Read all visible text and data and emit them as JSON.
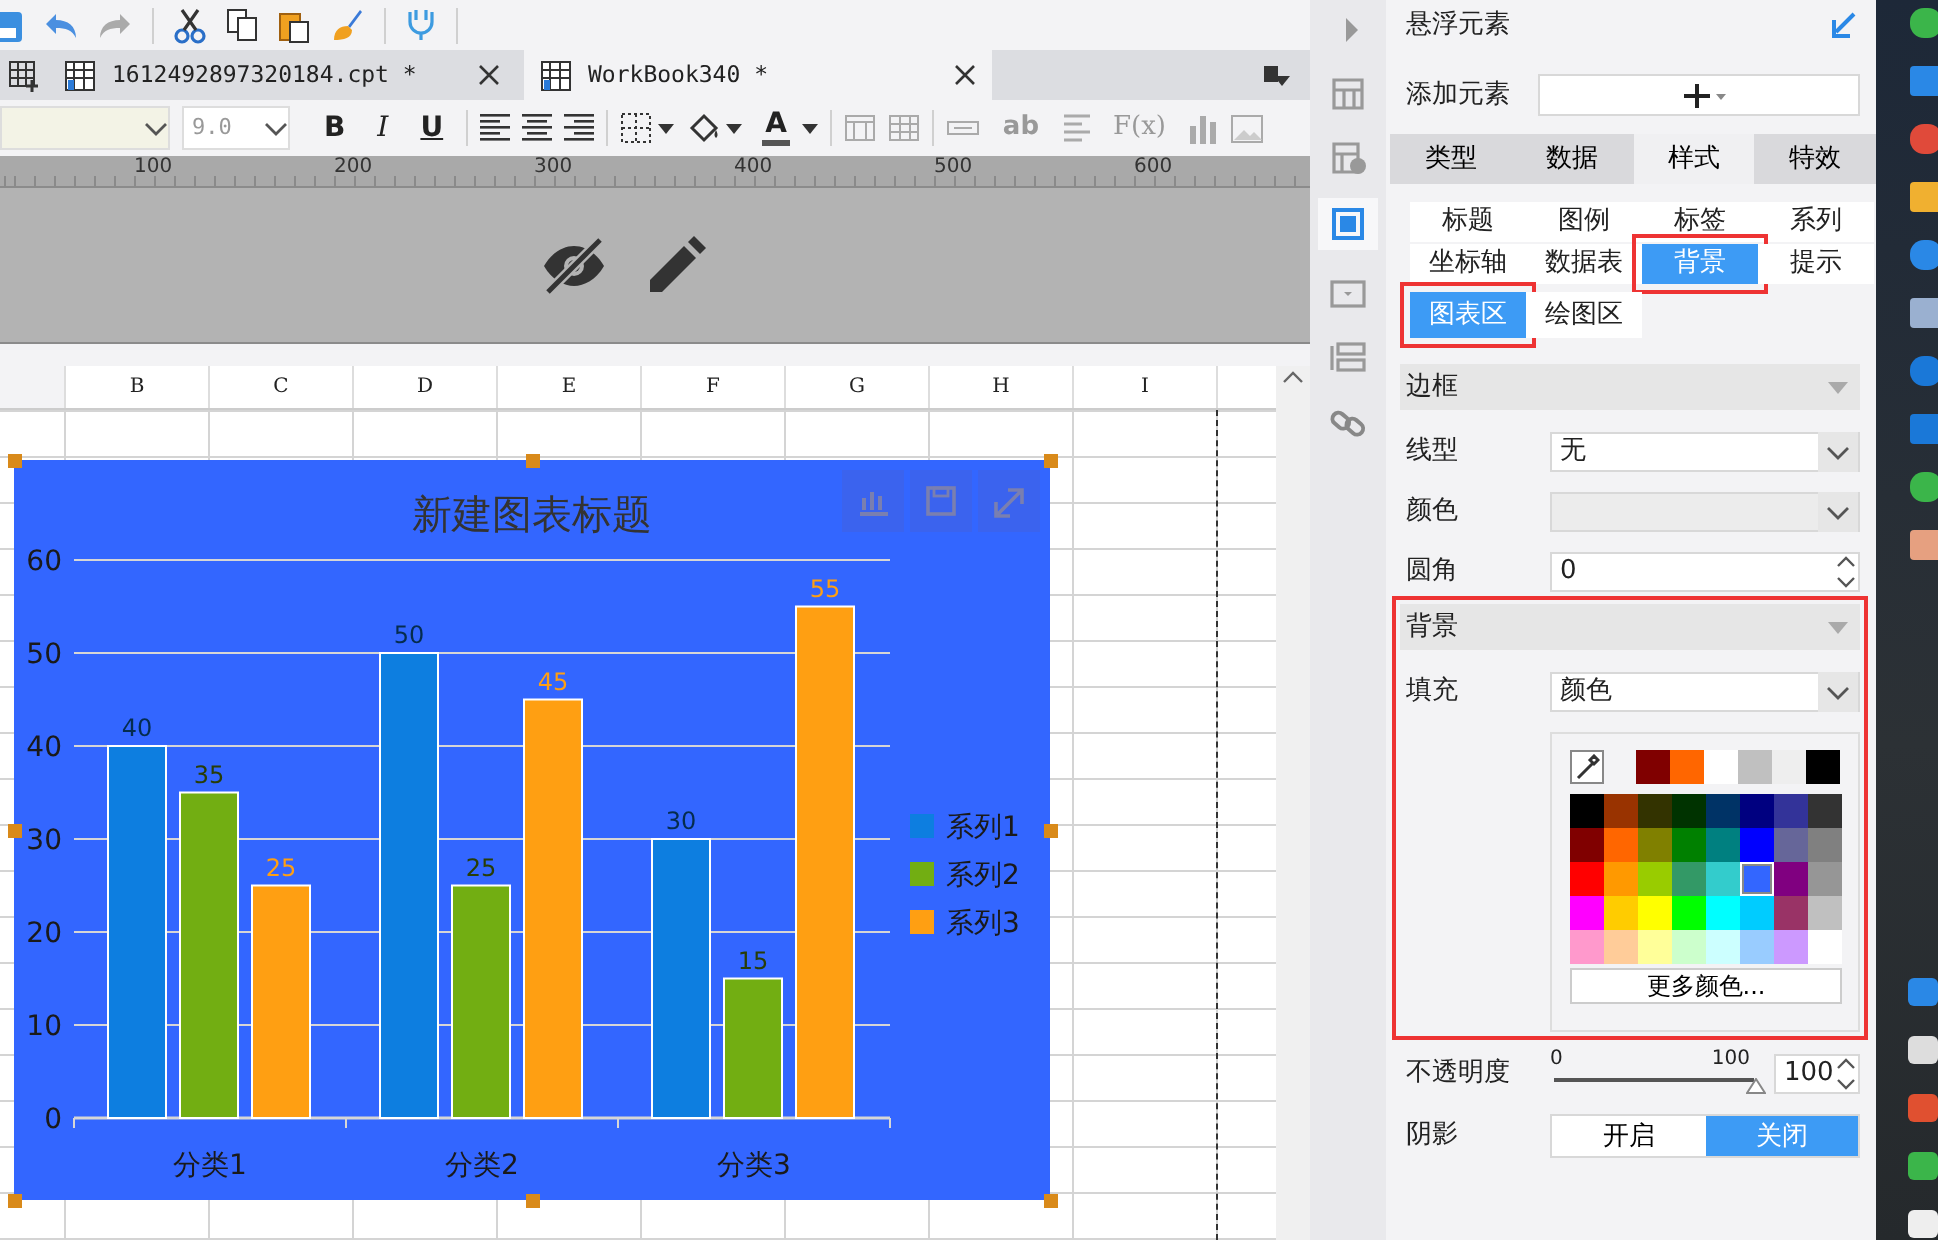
{
  "file_tabs": [
    {
      "label": "1612492897320184.cpt *",
      "selected": false
    },
    {
      "label": "WorkBook340 *",
      "selected": true
    }
  ],
  "format_bar": {
    "font_size": "9.0",
    "style_buttons": [
      "B",
      "I",
      "U"
    ],
    "font_color_label": "A",
    "text_tools": [
      "ab",
      "F(x)"
    ]
  },
  "ruler": {
    "labels": [
      "100",
      "200",
      "300",
      "400",
      "500",
      "600"
    ]
  },
  "sheet": {
    "columns": [
      "B",
      "C",
      "D",
      "E",
      "F",
      "G",
      "H",
      "I"
    ]
  },
  "chart": {
    "chart_data": {
      "type": "bar",
      "title": "新建图表标题",
      "categories": [
        "分类1",
        "分类2",
        "分类3"
      ],
      "series": [
        {
          "name": "系列1",
          "color": "#0d7ee0",
          "values": [
            40,
            50,
            30
          ]
        },
        {
          "name": "系列2",
          "color": "#72ae12",
          "values": [
            35,
            25,
            15
          ]
        },
        {
          "name": "系列3",
          "color": "#ff9f12",
          "values": [
            25,
            45,
            55
          ]
        }
      ],
      "ylim": [
        0,
        60
      ],
      "yticks": [
        0,
        10,
        20,
        30,
        40,
        50,
        60
      ],
      "data_labels": true,
      "grid": true,
      "legend": "right"
    }
  },
  "panel": {
    "title": "悬浮元素",
    "add_label": "添加元素",
    "tabs": [
      {
        "label": "类型",
        "selected": false
      },
      {
        "label": "数据",
        "selected": false
      },
      {
        "label": "样式",
        "selected": true
      },
      {
        "label": "特效",
        "selected": false
      }
    ],
    "style_tabs": [
      {
        "label": "标题",
        "selected": false,
        "highlighted": false
      },
      {
        "label": "图例",
        "selected": false,
        "highlighted": false
      },
      {
        "label": "标签",
        "selected": false,
        "highlighted": false
      },
      {
        "label": "系列",
        "selected": false,
        "highlighted": false
      },
      {
        "label": "坐标轴",
        "selected": false,
        "highlighted": false
      },
      {
        "label": "数据表",
        "selected": false,
        "highlighted": false
      },
      {
        "label": "背景",
        "selected": true,
        "highlighted": true
      },
      {
        "label": "提示",
        "selected": false,
        "highlighted": false
      }
    ],
    "area_tabs": [
      {
        "label": "图表区",
        "selected": true,
        "highlighted": true
      },
      {
        "label": "绘图区",
        "selected": false,
        "highlighted": false
      }
    ],
    "border_section": {
      "title": "边框",
      "line_type_label": "线型",
      "line_type": "无",
      "color_label": "颜色",
      "corner_label": "圆角",
      "corner": "0"
    },
    "background_section": {
      "title": "背景",
      "highlighted": true,
      "fill_label": "填充",
      "fill": "颜色",
      "recent_colors": [
        {
          "color": "#800000"
        },
        {
          "color": "#ff6600"
        },
        {
          "color": "#ffffff"
        },
        {
          "color": "#c0c0c0"
        },
        {
          "color": "#eeeeee"
        },
        {
          "color": "#000000"
        }
      ],
      "swatches": [
        [
          {
            "color": "#000000",
            "selected": false
          },
          {
            "color": "#993300",
            "selected": false
          },
          {
            "color": "#333300",
            "selected": false
          },
          {
            "color": "#003300",
            "selected": false
          },
          {
            "color": "#003366",
            "selected": false
          },
          {
            "color": "#000080",
            "selected": false
          },
          {
            "color": "#333399",
            "selected": false
          },
          {
            "color": "#333333",
            "selected": false
          }
        ],
        [
          {
            "color": "#800000",
            "selected": false
          },
          {
            "color": "#ff6600",
            "selected": false
          },
          {
            "color": "#808000",
            "selected": false
          },
          {
            "color": "#008000",
            "selected": false
          },
          {
            "color": "#008080",
            "selected": false
          },
          {
            "color": "#0000ff",
            "selected": false
          },
          {
            "color": "#666699",
            "selected": false
          },
          {
            "color": "#808080",
            "selected": false
          }
        ],
        [
          {
            "color": "#ff0000",
            "selected": false
          },
          {
            "color": "#ff9900",
            "selected": false
          },
          {
            "color": "#99cc00",
            "selected": false
          },
          {
            "color": "#339966",
            "selected": false
          },
          {
            "color": "#33cccc",
            "selected": false
          },
          {
            "color": "#3366ff",
            "selected": true
          },
          {
            "color": "#800080",
            "selected": false
          },
          {
            "color": "#969696",
            "selected": false
          }
        ],
        [
          {
            "color": "#ff00ff",
            "selected": false
          },
          {
            "color": "#ffcc00",
            "selected": false
          },
          {
            "color": "#ffff00",
            "selected": false
          },
          {
            "color": "#00ff00",
            "selected": false
          },
          {
            "color": "#00ffff",
            "selected": false
          },
          {
            "color": "#00ccff",
            "selected": false
          },
          {
            "color": "#993366",
            "selected": false
          },
          {
            "color": "#c0c0c0",
            "selected": false
          }
        ],
        [
          {
            "color": "#ff99cc",
            "selected": false
          },
          {
            "color": "#ffcc99",
            "selected": false
          },
          {
            "color": "#ffff99",
            "selected": false
          },
          {
            "color": "#ccffcc",
            "selected": false
          },
          {
            "color": "#ccffff",
            "selected": false
          },
          {
            "color": "#99ccff",
            "selected": false
          },
          {
            "color": "#cc99ff",
            "selected": false
          },
          {
            "color": "#ffffff",
            "selected": false
          }
        ]
      ],
      "more_button": "更多颜色...",
      "opacity_label": "不透明度",
      "opacity": {
        "min": "0",
        "max": "100",
        "level": 1,
        "value": "100"
      },
      "shadow_label": "阴影",
      "shadow_options": [
        {
          "label": "开启",
          "selected": false
        },
        {
          "label": "关闭",
          "selected": true
        }
      ]
    }
  }
}
